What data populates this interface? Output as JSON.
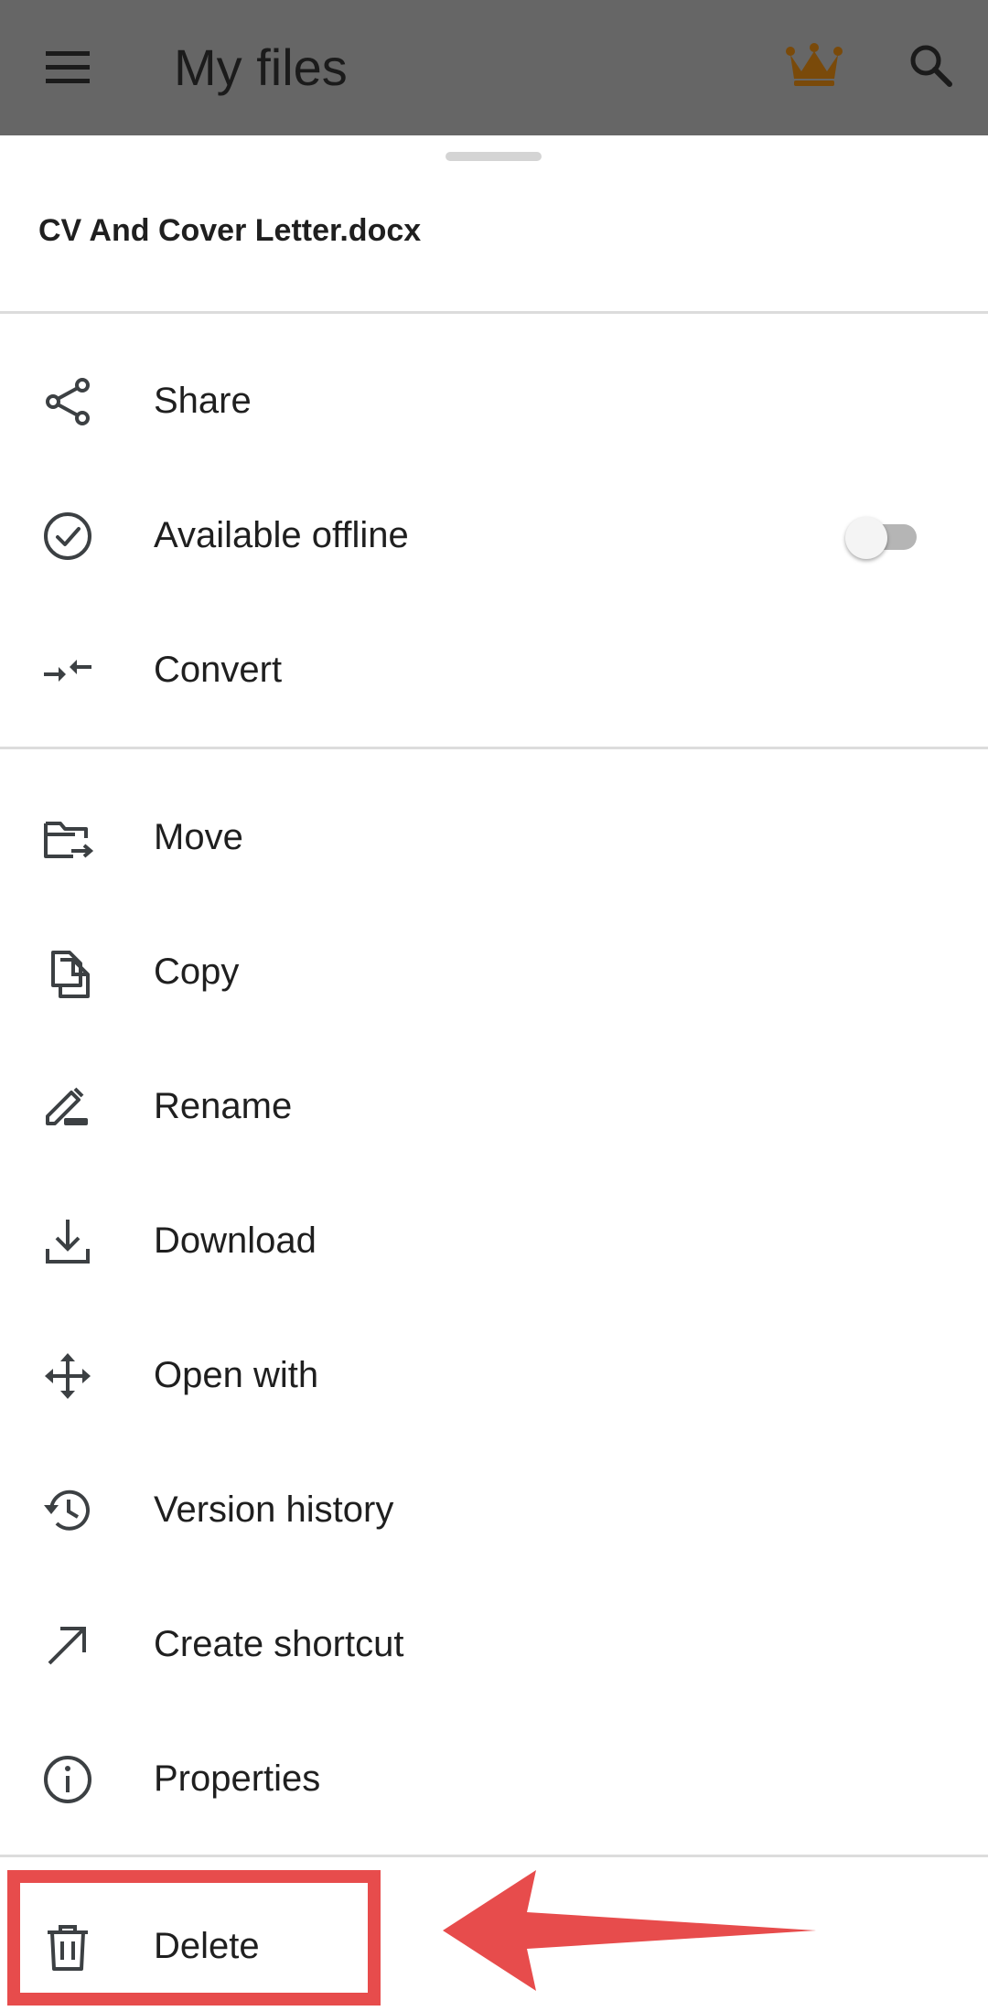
{
  "appbar": {
    "title": "My files",
    "menu_icon": "menu-icon",
    "premium_icon": "crown-icon",
    "search_icon": "search-icon",
    "premium_color": "#7a4a0a"
  },
  "sheet": {
    "file_name": "CV And Cover Letter.docx",
    "group1": [
      {
        "label": "Share",
        "icon": "share-icon"
      },
      {
        "label": "Available offline",
        "icon": "offline-check-icon",
        "toggle_on": false
      },
      {
        "label": "Convert",
        "icon": "convert-icon"
      }
    ],
    "group2": [
      {
        "label": "Move",
        "icon": "move-folder-icon"
      },
      {
        "label": "Copy",
        "icon": "copy-icon"
      },
      {
        "label": "Rename",
        "icon": "rename-icon"
      },
      {
        "label": "Download",
        "icon": "download-icon"
      },
      {
        "label": "Open with",
        "icon": "open-with-icon"
      },
      {
        "label": "Version history",
        "icon": "history-icon"
      },
      {
        "label": "Create shortcut",
        "icon": "shortcut-icon"
      },
      {
        "label": "Properties",
        "icon": "info-icon"
      }
    ],
    "group3": [
      {
        "label": "Delete",
        "icon": "trash-icon"
      }
    ]
  },
  "colors": {
    "appbar_scrim": "#666666",
    "icon": "#3c4043",
    "annotation": "#e74c4c"
  }
}
